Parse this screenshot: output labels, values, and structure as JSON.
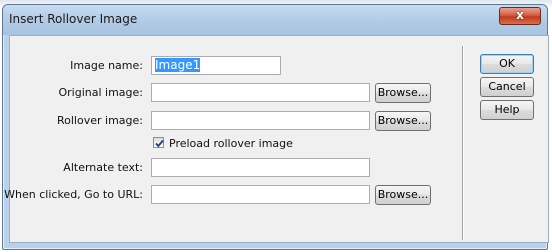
{
  "window": {
    "title": "Insert Rollover Image",
    "close_glyph": "x"
  },
  "form": {
    "image_name": {
      "label": "Image name:",
      "value": "Image1"
    },
    "original_image": {
      "label": "Original image:",
      "value": ""
    },
    "rollover_image": {
      "label": "Rollover image:",
      "value": ""
    },
    "preload": {
      "label": "Preload rollover image",
      "checked": true
    },
    "alternate_text": {
      "label": "Alternate text:",
      "value": ""
    },
    "goto_url": {
      "label": "When clicked, Go to URL:",
      "value": ""
    },
    "browse_label": "Browse..."
  },
  "buttons": {
    "ok": "OK",
    "cancel": "Cancel",
    "help": "Help"
  },
  "colors": {
    "accent": "#3399ff",
    "close_red": "#c2391b"
  },
  "icons": {
    "close": "close-icon",
    "checkmark": "checkmark-icon"
  }
}
